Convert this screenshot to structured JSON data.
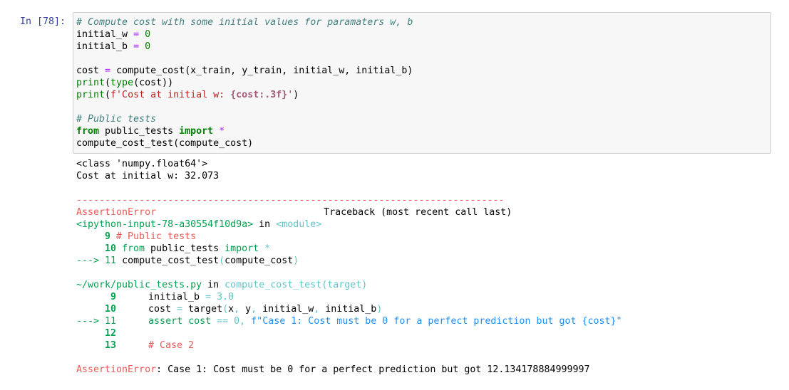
{
  "cell": {
    "prompt": "In [78]:",
    "code": {
      "l1": "# Compute cost with some initial values for paramaters w, b",
      "l2": {
        "name": "initial_w",
        "eq": "=",
        "val": "0"
      },
      "l3": {
        "name": "initial_b",
        "eq": "=",
        "val": "0"
      },
      "l5": {
        "name": "cost",
        "eq": "=",
        "rest": "compute_cost(x_train, y_train, initial_w, initial_b)"
      },
      "l6": {
        "fn": "print",
        "a": "(",
        "fn2": "type",
        "b": "(cost))"
      },
      "l7": {
        "fn": "print",
        "a": "(",
        "s1": "f'Cost at initial w: ",
        "interp": "{cost:.3f}",
        "s2": "'",
        "b": ")"
      },
      "l9": "# Public tests",
      "l10": {
        "from": "from",
        "mod": " public_tests ",
        "imp": "import",
        "star": " *"
      },
      "l11": "compute_cost_test(compute_cost)"
    }
  },
  "output": {
    "o1": "<class 'numpy.float64'>",
    "o2": "Cost at initial w: 32.073",
    "dashes": "---------------------------------------------------------------------------",
    "tb_err": "AssertionError",
    "tb_head": "Traceback (most recent call last)",
    "frame1": {
      "input": "<ipython-input-78-a30554f10d9a>",
      "in": " in ",
      "module": "<module>"
    },
    "f1l1": {
      "n": "9",
      "text": "# Public tests"
    },
    "f1l2": {
      "n": "10",
      "from": "from",
      "mid": " public_tests ",
      "imp": "import",
      "star": " *"
    },
    "f1l3": {
      "arrow": "---> 11",
      "fn": "compute_cost_test",
      "p1": "(",
      "arg": "compute_cost",
      "p2": ")"
    },
    "frame2": {
      "file": "~/work/public_tests.py",
      "in": " in ",
      "fn": "compute_cost_test(target)"
    },
    "f2l1": {
      "n": "9",
      "pre": "initial_b ",
      "eq": "=",
      "val": " 3.0"
    },
    "f2l2": {
      "n": "10",
      "pre": "cost ",
      "eq": "=",
      "rest1": " target",
      "p1": "(",
      "args1": "x",
      "c1": ",",
      "args2": " y",
      "c2": ",",
      "args3": " initial_w",
      "c3": ",",
      "args4": " initial_b",
      "p2": ")"
    },
    "f2l3": {
      "arrow": "---> 11",
      "pre": "assert cost ",
      "eq": "==",
      "val": " 0",
      "c": ",",
      "str": " f\"Case 1: Cost must be 0 for a perfect prediction but got {cost}\""
    },
    "f2l4": {
      "n": "12"
    },
    "f2l5": {
      "n": "13",
      "text": "# Case 2"
    },
    "final_err": "AssertionError",
    "final_msg": ": Case 1: Cost must be 0 for a perfect prediction but got 12.134178884999997"
  }
}
